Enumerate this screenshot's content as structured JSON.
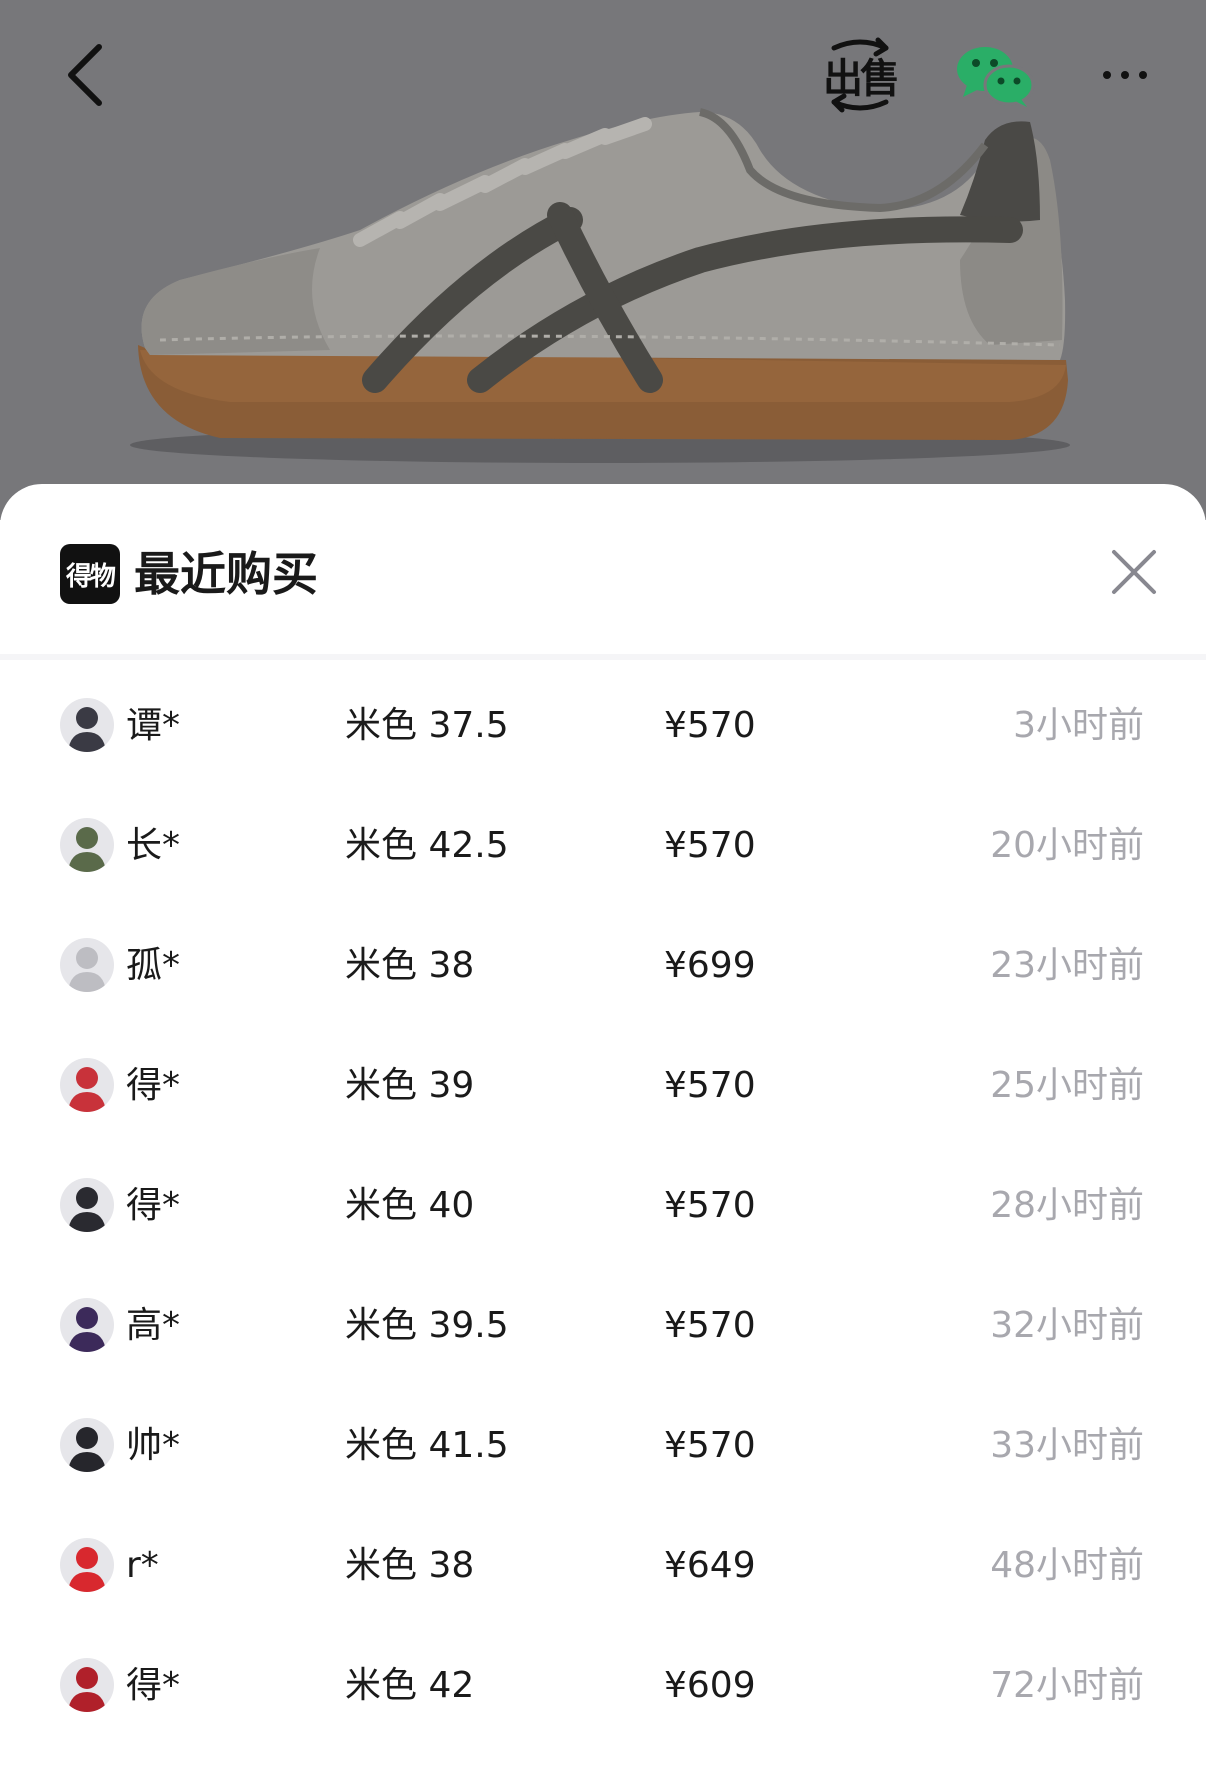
{
  "toolbar": {
    "sell_label": "出售"
  },
  "sheet": {
    "brand_logo_text": "得物",
    "title": "最近购买"
  },
  "purchases": [
    {
      "user": "谭*",
      "spec": "米色 37.5",
      "price": "¥570",
      "time": "3小时前",
      "avatar_color": "#3a3a44"
    },
    {
      "user": "长*",
      "spec": "米色 42.5",
      "price": "¥570",
      "time": "20小时前",
      "avatar_color": "#5a6a4a"
    },
    {
      "user": "孤*",
      "spec": "米色 38",
      "price": "¥699",
      "time": "23小时前",
      "avatar_color": "#bdbdc2"
    },
    {
      "user": "得*",
      "spec": "米色 39",
      "price": "¥570",
      "time": "25小时前",
      "avatar_color": "#c8323a"
    },
    {
      "user": "得*",
      "spec": "米色 40",
      "price": "¥570",
      "time": "28小时前",
      "avatar_color": "#2a2a30"
    },
    {
      "user": "高*",
      "spec": "米色 39.5",
      "price": "¥570",
      "time": "32小时前",
      "avatar_color": "#3c2a5a"
    },
    {
      "user": "帅*",
      "spec": "米色 41.5",
      "price": "¥570",
      "time": "33小时前",
      "avatar_color": "#26262c"
    },
    {
      "user": "r*",
      "spec": "米色 38",
      "price": "¥649",
      "time": "48小时前",
      "avatar_color": "#d8282e"
    },
    {
      "user": "得*",
      "spec": "米色 42",
      "price": "¥609",
      "time": "72小时前",
      "avatar_color": "#b0202a"
    }
  ],
  "colors": {
    "overlay": "#77777a",
    "time_text": "#a8a8ae",
    "wechat_green": "#2aae67"
  },
  "icons": {
    "back": "chevron-left-icon",
    "sell": "sell-icon",
    "share": "wechat-icon",
    "more": "more-dots-icon",
    "close": "close-icon"
  }
}
